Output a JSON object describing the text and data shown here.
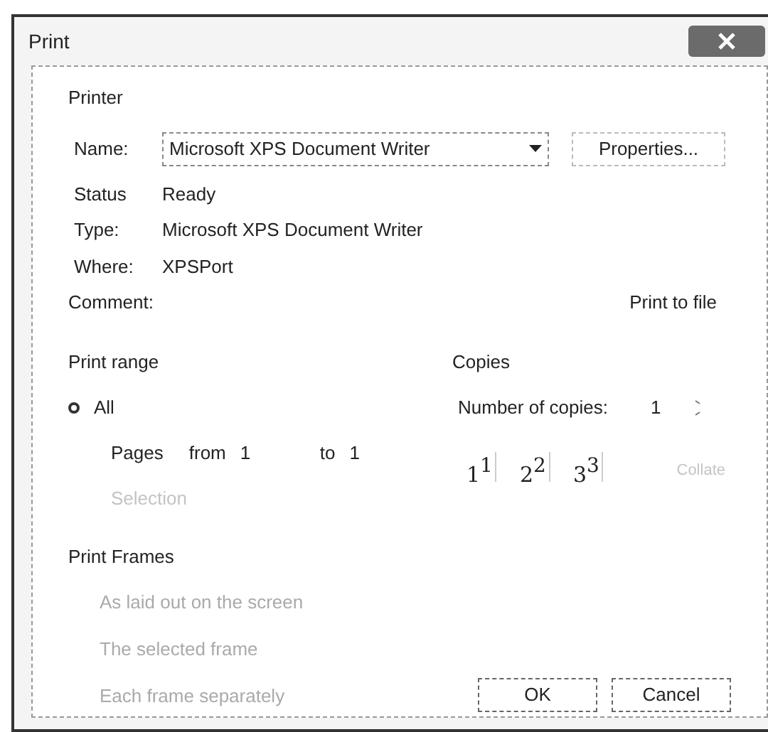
{
  "window": {
    "title": "Print"
  },
  "printer": {
    "heading": "Printer",
    "name_label": "Name:",
    "name_value": "Microsoft XPS Document Writer",
    "properties_button": "Properties...",
    "info": [
      {
        "label": "Status",
        "value": "Ready"
      },
      {
        "label": "Type:",
        "value": "Microsoft XPS Document Writer"
      },
      {
        "label": "Where:",
        "value": "XPSPort"
      }
    ],
    "comment_label": "Comment:",
    "print_to_file": "Print to file"
  },
  "print_range": {
    "heading": "Print range",
    "options": [
      {
        "kind": "radio",
        "label": "All",
        "selected": true,
        "disabled": false
      },
      {
        "kind": "pages",
        "label": "Pages",
        "selected": false,
        "disabled": false,
        "from_label": "from",
        "from_value": "1",
        "to_label": "to",
        "to_value": "1"
      },
      {
        "kind": "radio",
        "label": "Selection",
        "selected": false,
        "disabled": true
      }
    ]
  },
  "copies": {
    "heading": "Copies",
    "number_label": "Number of copies:",
    "number_value": "1",
    "collate_pages": [
      {
        "front": "1",
        "back": "1"
      },
      {
        "front": "2",
        "back": "2"
      },
      {
        "front": "3",
        "back": "3"
      }
    ],
    "collate_label": "Collate",
    "collate_disabled": true
  },
  "print_frames": {
    "heading": "Print Frames",
    "options": [
      {
        "label": "As laid out on the screen",
        "disabled": true
      },
      {
        "label": "The selected frame",
        "disabled": true
      },
      {
        "label": "Each frame separately",
        "disabled": true
      }
    ]
  },
  "buttons": [
    "OK",
    "Cancel"
  ]
}
